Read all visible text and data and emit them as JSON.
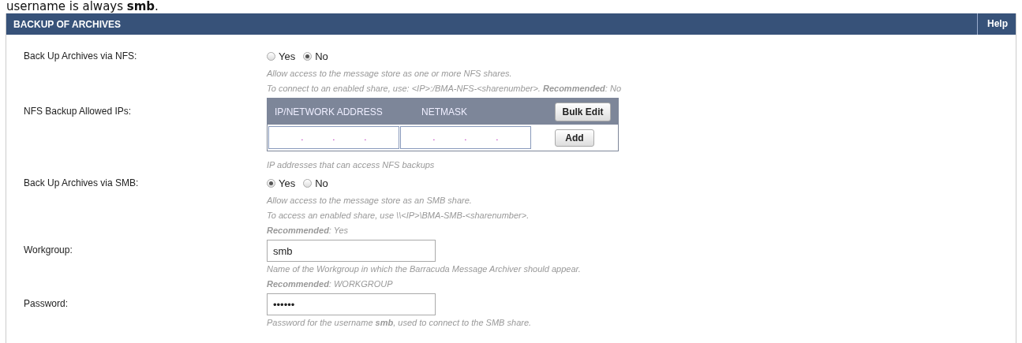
{
  "caption": "username is always **smb**.",
  "section": {
    "title": "BACKUP OF ARCHIVES",
    "help": "Help"
  },
  "rows": [
    {
      "kind": "radio",
      "label": "Back Up Archives via NFS:",
      "options": [
        {
          "label": "Yes",
          "selected": false
        },
        {
          "label": "No",
          "selected": true
        }
      ],
      "help": [
        "Allow access to the message store as one or more NFS shares.",
        "To connect to an enabled share, use: <IP>:/BMA-NFS-<sharenumber>. **Recommended**: No"
      ]
    },
    {
      "kind": "ip_table",
      "label": "NFS Backup Allowed IPs:",
      "columns": [
        "IP/NETWORK ADDRESS",
        "NETMASK"
      ],
      "bulk_button": "Bulk Edit",
      "add_button": "Add",
      "separator": ".",
      "help": [
        "IP addresses that can access NFS backups"
      ]
    },
    {
      "kind": "radio",
      "label": "Back Up Archives via SMB:",
      "options": [
        {
          "label": "Yes",
          "selected": true
        },
        {
          "label": "No",
          "selected": false
        }
      ],
      "help": [
        "Allow access to the message store as an SMB share.",
        "To access an enabled share, use \\\\<IP>\\BMA-SMB-<sharenumber>.",
        "**Recommended**: Yes"
      ]
    },
    {
      "kind": "text",
      "label": "Workgroup:",
      "value": "smb",
      "help": [
        "Name of the Workgroup in which the Barracuda Message Archiver should appear.",
        "**Recommended**: WORKGROUP"
      ]
    },
    {
      "kind": "text",
      "label": "Password:",
      "value": "••••••",
      "help": [
        "Password for the username **smb**, used to connect to the SMB share."
      ]
    }
  ]
}
